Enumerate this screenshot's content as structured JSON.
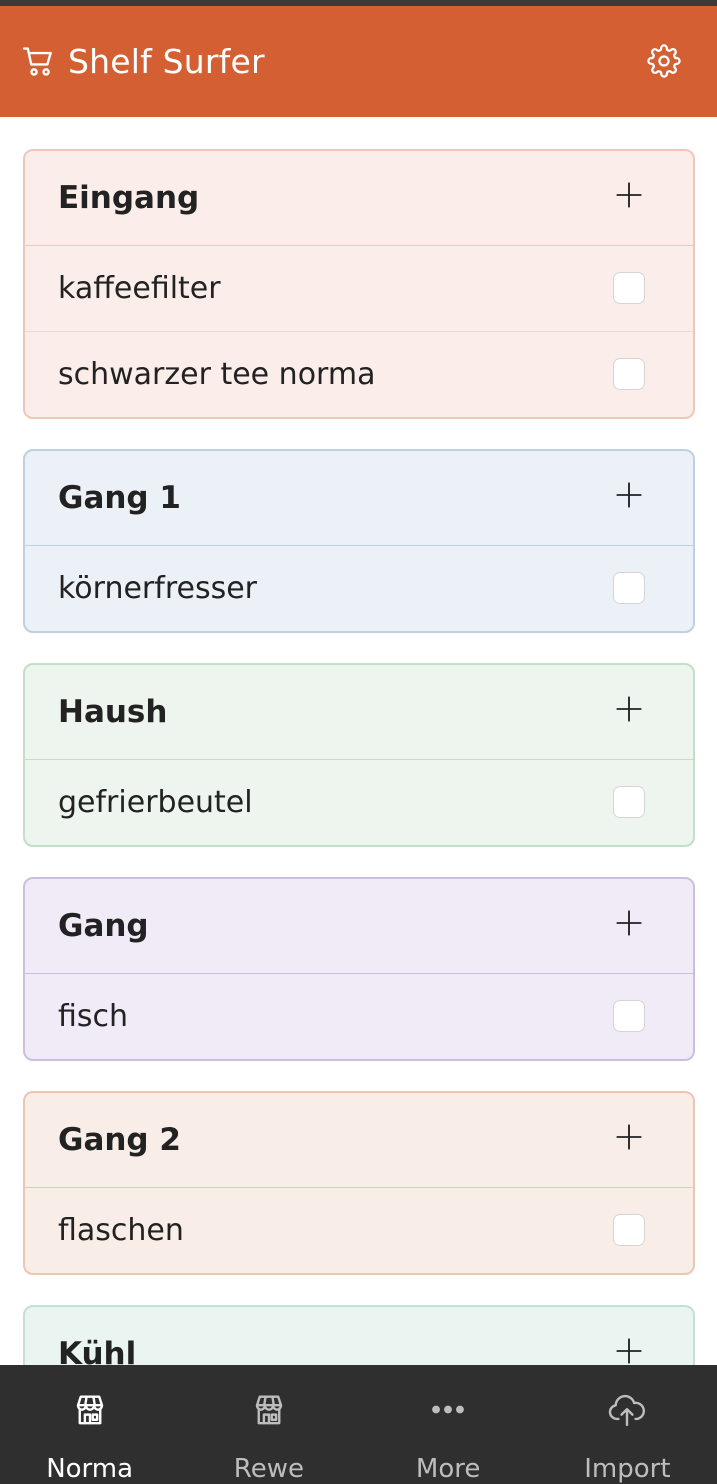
{
  "app": {
    "title": "Shelf Surfer",
    "icons": {
      "cart": "cart-icon",
      "settings": "gear-icon"
    },
    "colors": {
      "header": "#d45f32",
      "nav_bg": "#2f2f2f",
      "nav_active": "#ffffff",
      "nav_inactive": "#bdbdbd"
    }
  },
  "sections": [
    {
      "title": "Eingang",
      "bg": "#fbeeea",
      "border": "#efc7b8",
      "items": [
        "kaffeefilter",
        "schwarzer tee norma"
      ]
    },
    {
      "title": "Gang 1",
      "bg": "#ebf1f6",
      "border": "#bdd1e0",
      "items": [
        "körnerfresser"
      ]
    },
    {
      "title": "Haush",
      "bg": "#edf5ee",
      "border": "#c3dfc6",
      "items": [
        "gefrierbeutel"
      ]
    },
    {
      "title": "Gang",
      "bg": "#f1eaf7",
      "border": "#cdbfdc",
      "items": [
        "fisch"
      ]
    },
    {
      "title": "Gang 2",
      "bg": "#f9ede7",
      "border": "#ebc6b4",
      "items": [
        "flaschen"
      ]
    },
    {
      "title": "Kühl",
      "bg": "#eaf5f1",
      "border": "#c3e0d5",
      "items": []
    }
  ],
  "nav": [
    {
      "label": "Norma",
      "icon": "store-icon",
      "active": true
    },
    {
      "label": "Rewe",
      "icon": "store-icon",
      "active": false
    },
    {
      "label": "More",
      "icon": "more-icon",
      "active": false
    },
    {
      "label": "Import",
      "icon": "cloud-upload-icon",
      "active": false
    }
  ]
}
